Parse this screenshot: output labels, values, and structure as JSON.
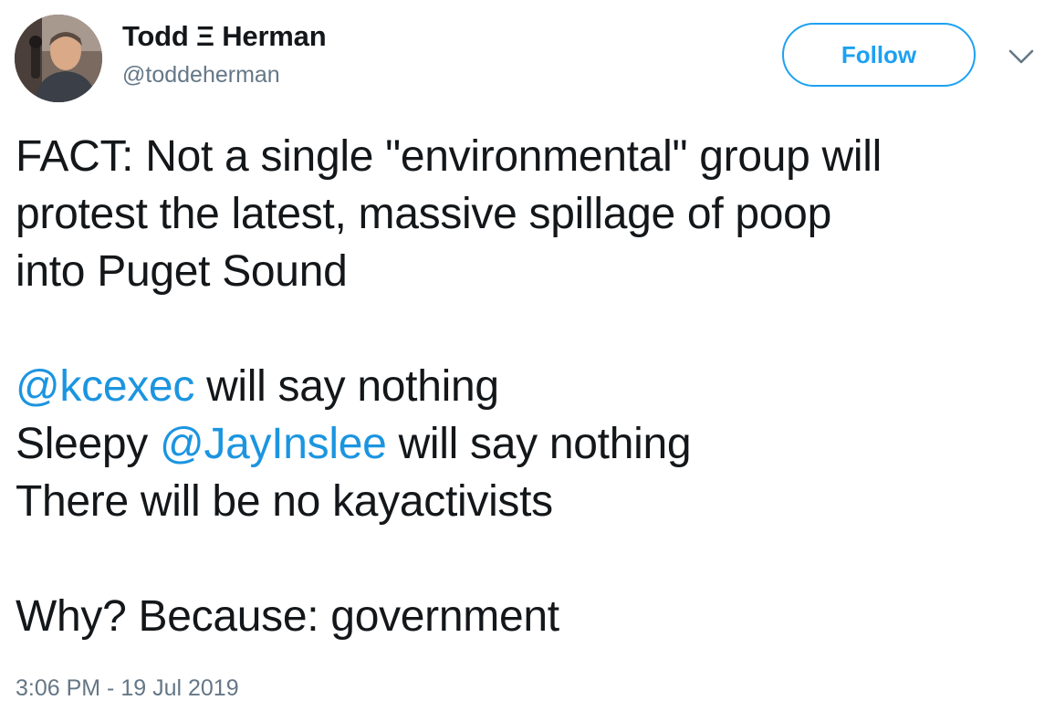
{
  "author": {
    "display_name": "Todd Ξ Herman",
    "handle": "@toddeherman"
  },
  "actions": {
    "follow_label": "Follow",
    "more_icon": "chevron-down-icon"
  },
  "tweet": {
    "line1": "FACT: Not a single \"environmental\" group will",
    "line2": "protest the latest, massive spillage of poop",
    "line3": "into Puget Sound",
    "mention1": "@kcexec",
    "line4_rest": " will say nothing",
    "line5_prefix": "Sleepy ",
    "mention2": "@JayInslee",
    "line5_rest": " will say nothing",
    "line6": "There will be no kayactivists",
    "line7": "Why? Because: government"
  },
  "timestamp": "3:06 PM - 19 Jul 2019",
  "colors": {
    "accent": "#1da1f2",
    "mention": "#1b95e0",
    "text": "#14171a",
    "secondary": "#657786"
  }
}
